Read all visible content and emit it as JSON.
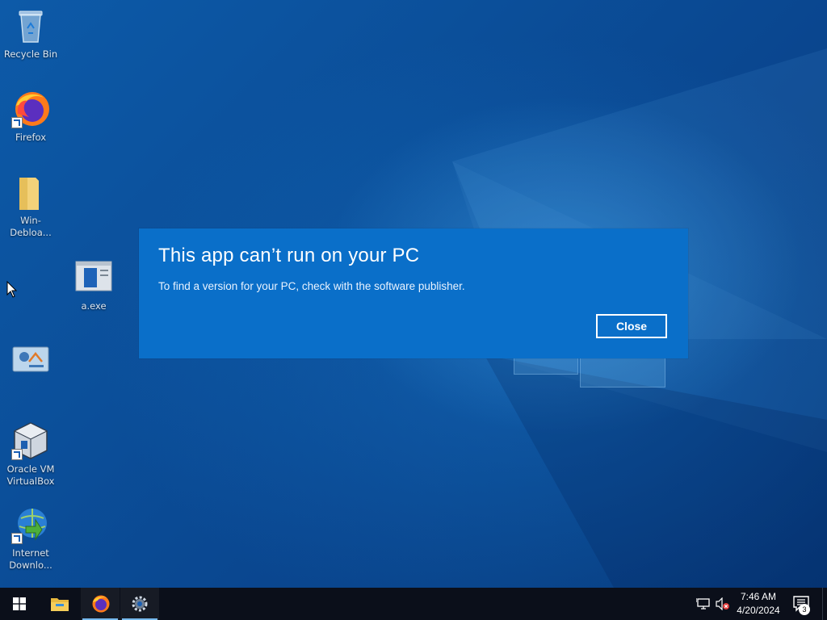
{
  "desktop": {
    "icons": [
      {
        "label": "Recycle Bin",
        "icon": "recycle-bin-icon"
      },
      {
        "label": "Firefox",
        "icon": "firefox-icon"
      },
      {
        "label": "Win-Debloa...",
        "icon": "folder-icon"
      },
      {
        "label": "a.exe",
        "icon": "executable-icon"
      },
      {
        "label": "",
        "icon": "control-panel-icon"
      },
      {
        "label": "Oracle VM VirtualBox",
        "icon": "virtualbox-icon"
      },
      {
        "label": "Internet Downlo...",
        "icon": "internet-download-manager-icon"
      }
    ]
  },
  "dialog": {
    "title": "This app can’t run on your PC",
    "message": "To find a version for your PC, check with the software publisher.",
    "close_label": "Close",
    "background": "#0a6fc9"
  },
  "taskbar": {
    "pinned": [
      {
        "name": "start",
        "icon": "windows-start-icon"
      },
      {
        "name": "file-explorer",
        "icon": "folder-icon"
      },
      {
        "name": "firefox",
        "icon": "firefox-icon",
        "active": true
      },
      {
        "name": "settings",
        "icon": "gear-icon",
        "active": true
      }
    ],
    "tray": {
      "network_icon": "network-icon",
      "volume_icon": "volume-muted-icon",
      "time": "7:46 AM",
      "date": "4/20/2024",
      "notification_count": "3"
    }
  },
  "colors": {
    "taskbar": "#0b0f1a",
    "accent": "#76b9ed"
  }
}
